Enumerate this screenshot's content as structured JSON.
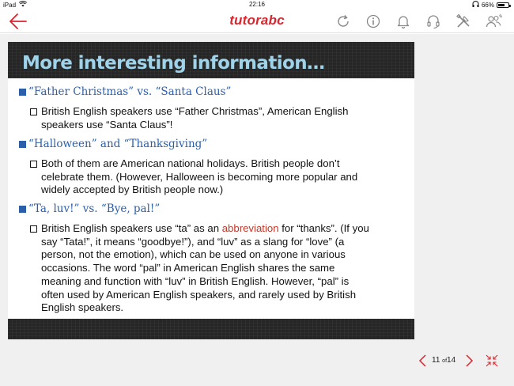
{
  "status_bar": {
    "device": "iPad",
    "time": "22:16",
    "battery": "66%",
    "battery_level": 0.66
  },
  "app": {
    "logo_text": "tutorabc",
    "accent_color": "#d8262e"
  },
  "toolbar": {
    "icons": [
      "refresh-icon",
      "info-icon",
      "bell-icon",
      "headset-icon",
      "tools-icon",
      "users-icon"
    ]
  },
  "slide": {
    "title": "More interesting information…",
    "sections": [
      {
        "heading": "“Father Christmas” vs. “Santa Claus”",
        "body_lines": [
          "British English speakers use “Father Christmas”, American English",
          "speakers use “Santa Claus”!"
        ]
      },
      {
        "heading": "“Halloween” and “Thanksgiving”",
        "body_lines": [
          "Both of them are American national holidays. British people don’t",
          "celebrate them. (However, Halloween is becoming more popular and",
          "widely accepted by British people now.)"
        ]
      },
      {
        "heading": "“Ta, luv!” vs. “Bye, pal!”",
        "body_line1_before": "British English speakers use “ta” as an ",
        "body_line1_highlight": "abbreviation",
        "body_line1_after": " for “thanks”. (If you",
        "body_lines": [
          "say “Tata!”, it means “goodbye!”), and “luv” as a slang for “love” (a",
          "person, not the emotion), which can be used on anyone in various",
          "occasions. The word “pal” in American English shares the same",
          "meaning and function with “luv” in British English. However, “pal” is",
          "often used by American English speakers, and rarely used by British",
          "English speakers."
        ]
      }
    ],
    "heading_color": "#2c5faa",
    "title_color": "#9fd3ea"
  },
  "pager": {
    "current": "11",
    "of_label": "of",
    "total": "14"
  }
}
